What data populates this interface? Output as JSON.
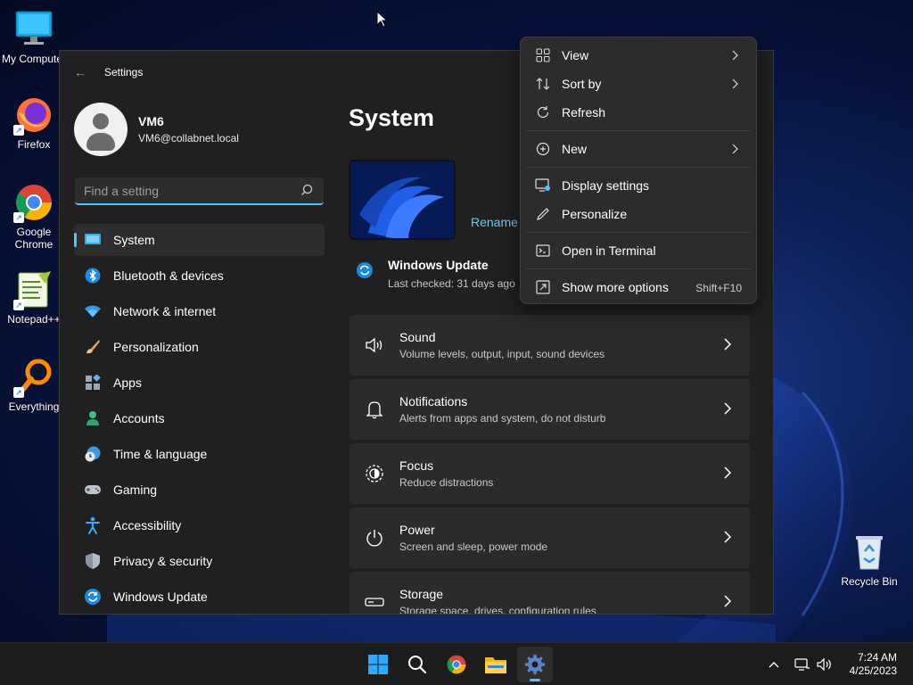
{
  "desktop": {
    "icons": [
      {
        "label": "My Computer",
        "icon": "monitor-icon"
      },
      {
        "label": "Firefox",
        "icon": "firefox-icon"
      },
      {
        "label": "Google Chrome",
        "icon": "chrome-icon"
      },
      {
        "label": "Notepad++",
        "icon": "notepadpp-icon"
      },
      {
        "label": "Everything",
        "icon": "everything-icon"
      },
      {
        "label": "Recycle Bin",
        "icon": "recycle-bin-icon"
      }
    ]
  },
  "settings": {
    "window_title": "Settings",
    "profile": {
      "name": "VM6",
      "email": "VM6@collabnet.local"
    },
    "search": {
      "placeholder": "Find a setting",
      "value": ""
    },
    "nav": [
      {
        "label": "System",
        "icon": "system-icon",
        "active": true
      },
      {
        "label": "Bluetooth & devices",
        "icon": "bluetooth-icon"
      },
      {
        "label": "Network & internet",
        "icon": "wifi-icon"
      },
      {
        "label": "Personalization",
        "icon": "brush-icon"
      },
      {
        "label": "Apps",
        "icon": "apps-icon"
      },
      {
        "label": "Accounts",
        "icon": "accounts-icon"
      },
      {
        "label": "Time & language",
        "icon": "clock-globe-icon"
      },
      {
        "label": "Gaming",
        "icon": "gamepad-icon"
      },
      {
        "label": "Accessibility",
        "icon": "accessibility-icon"
      },
      {
        "label": "Privacy & security",
        "icon": "shield-icon"
      },
      {
        "label": "Windows Update",
        "icon": "update-icon"
      }
    ],
    "main": {
      "title": "System",
      "rename_label": "Rename",
      "windows_update": {
        "title": "Windows Update",
        "subtitle": "Last checked: 31 days ago"
      },
      "cards": [
        {
          "title": "Sound",
          "subtitle": "Volume levels, output, input, sound devices",
          "icon": "speaker-icon"
        },
        {
          "title": "Notifications",
          "subtitle": "Alerts from apps and system, do not disturb",
          "icon": "bell-icon"
        },
        {
          "title": "Focus",
          "subtitle": "Reduce distractions",
          "icon": "focus-icon"
        },
        {
          "title": "Power",
          "subtitle": "Screen and sleep, power mode",
          "icon": "power-icon"
        },
        {
          "title": "Storage",
          "subtitle": "Storage space, drives, configuration rules",
          "icon": "storage-icon"
        }
      ]
    }
  },
  "context_menu": {
    "items": [
      {
        "label": "View",
        "icon": "grid-view-icon",
        "submenu": true
      },
      {
        "label": "Sort by",
        "icon": "sort-icon",
        "submenu": true
      },
      {
        "label": "Refresh",
        "icon": "refresh-icon"
      },
      {
        "label": "New",
        "icon": "plus-circle-icon",
        "submenu": true
      },
      {
        "label": "Display settings",
        "icon": "display-settings-icon"
      },
      {
        "label": "Personalize",
        "icon": "pen-icon"
      },
      {
        "label": "Open in Terminal",
        "icon": "terminal-icon"
      },
      {
        "label": "Show more options",
        "icon": "more-options-icon",
        "shortcut": "Shift+F10"
      }
    ]
  },
  "taskbar": {
    "apps": [
      "start-icon",
      "search-icon",
      "chrome-icon",
      "file-explorer-icon",
      "settings-icon"
    ],
    "clock": {
      "time": "7:24 AM",
      "date": "4/25/2023"
    }
  },
  "colors": {
    "accent": "#4cc2ff",
    "link": "#60cdff",
    "window_bg": "#202020",
    "card_bg": "#2b2b2b"
  }
}
